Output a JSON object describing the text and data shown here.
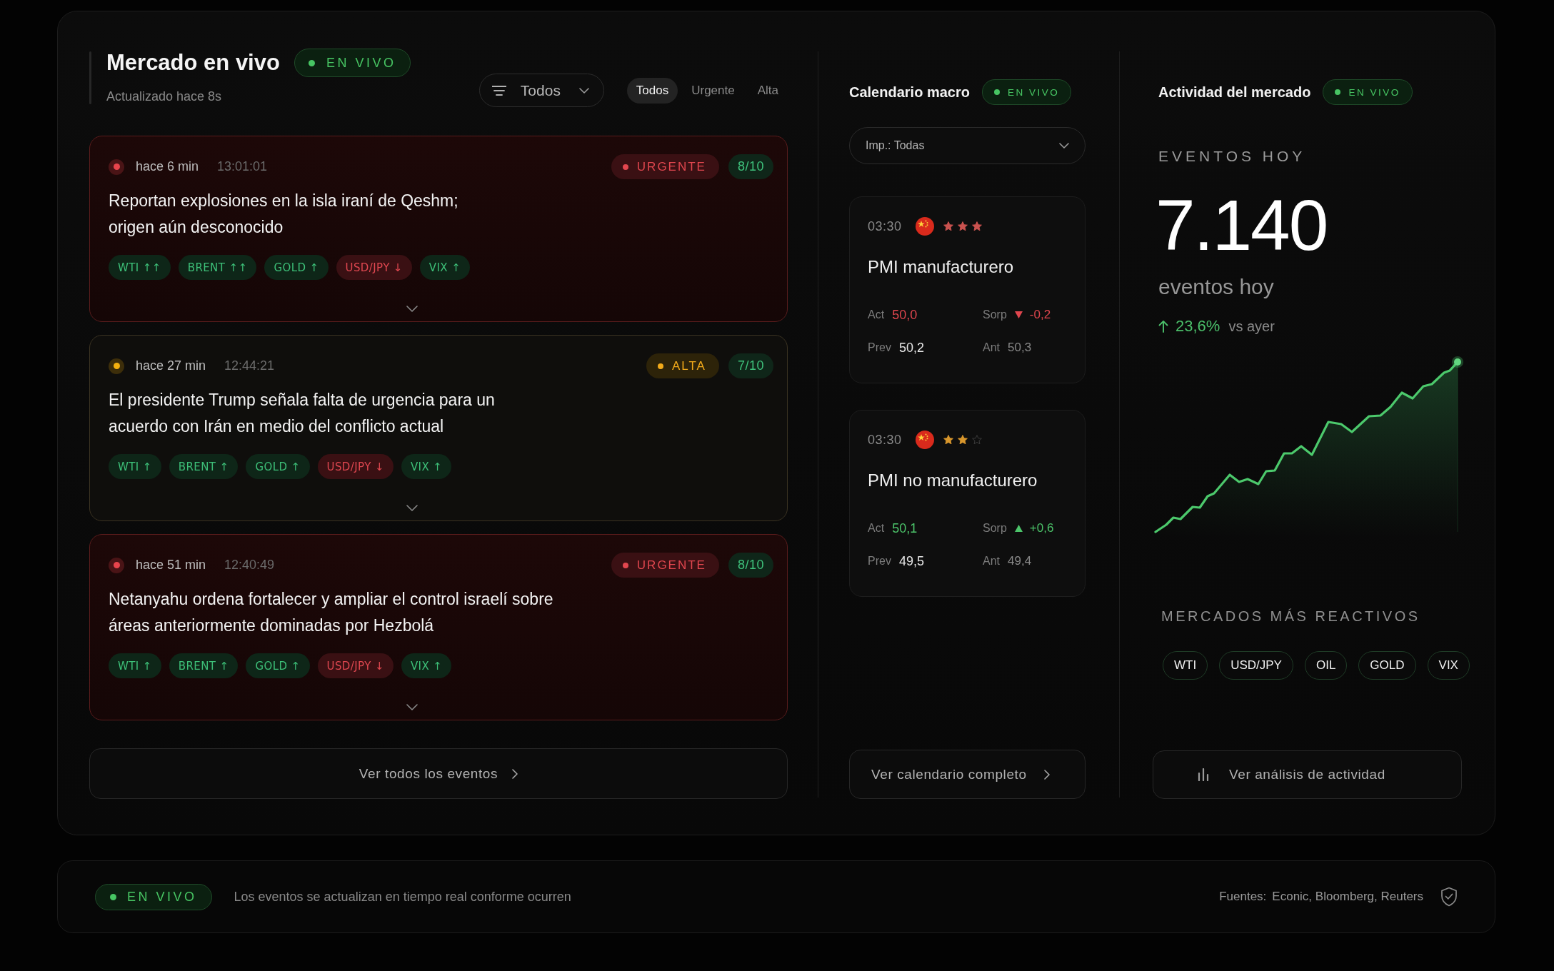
{
  "header": {
    "title": "Mercado en vivo",
    "live_badge": "EN VIVO",
    "subtitle": "Actualizado hace 8s",
    "filter": {
      "value": "Todos"
    },
    "tabs": [
      {
        "label": "Todos",
        "selected": true
      },
      {
        "label": "Urgente",
        "selected": false
      },
      {
        "label": "Alta",
        "selected": false
      }
    ]
  },
  "events": [
    {
      "kind": "urgent",
      "age": "hace 6 min",
      "time": "13:01:01",
      "badge": "URGENTE",
      "score": "8/10",
      "headline": "Reportan explosiones en la isla iraní de Qeshm;\norigen aún desconocido",
      "tags": [
        {
          "label": "WTI ↑↑",
          "rising": true
        },
        {
          "label": "BRENT ↑↑",
          "rising": true
        },
        {
          "label": "GOLD ↑",
          "rising": true
        },
        {
          "label": "USD/JPY ↓",
          "rising": false
        },
        {
          "label": "VIX ↑",
          "rising": true
        }
      ]
    },
    {
      "kind": "high",
      "age": "hace 27 min",
      "time": "12:44:21",
      "badge": "ALTA",
      "score": "7/10",
      "headline": "El presidente Trump señala falta de urgencia para un\nacuerdo con Irán en medio del conflicto actual",
      "tags": [
        {
          "label": "WTI ↑",
          "rising": true
        },
        {
          "label": "BRENT ↑",
          "rising": true
        },
        {
          "label": "GOLD ↑",
          "rising": true
        },
        {
          "label": "USD/JPY ↓",
          "rising": false
        },
        {
          "label": "VIX ↑",
          "rising": true
        }
      ]
    },
    {
      "kind": "urgent",
      "age": "hace 51 min",
      "time": "12:40:49",
      "badge": "URGENTE",
      "score": "8/10",
      "headline": "Netanyahu ordena fortalecer y ampliar el control israelí sobre\náreas anteriormente dominadas por Hezbolá",
      "tags": [
        {
          "label": "WTI ↑",
          "rising": true
        },
        {
          "label": "BRENT ↑",
          "rising": true
        },
        {
          "label": "GOLD ↑",
          "rising": true
        },
        {
          "label": "USD/JPY ↓",
          "rising": false
        },
        {
          "label": "VIX ↑",
          "rising": true
        }
      ]
    }
  ],
  "events_button": "Ver todos los eventos",
  "calendar": {
    "title": "Calendario macro",
    "live_badge": "EN VIVO",
    "filter": {
      "value": "Imp.: Todas"
    },
    "items": [
      {
        "time": "03:30",
        "stars": 3,
        "title": "PMI manufacturero",
        "rising": false,
        "act_label": "Act",
        "act": "50,0",
        "surprise_label": "Sorp",
        "surprise": "-0,2",
        "prev_label": "Prev",
        "prev": "50,2",
        "ant_label": "Ant",
        "ant": "50,3"
      },
      {
        "time": "03:30",
        "stars": 2,
        "title": "PMI no manufacturero",
        "rising": true,
        "act_label": "Act",
        "act": "50,1",
        "surprise_label": "Sorp",
        "surprise": "+0,6",
        "prev_label": "Prev",
        "prev": "49,5",
        "ant_label": "Ant",
        "ant": "49,4"
      }
    ],
    "button": "Ver calendario completo"
  },
  "activity": {
    "title": "Actividad del mercado",
    "live_badge": "EN VIVO",
    "kicker": "EVENTOS HOY",
    "count": "7.140",
    "count_label": "eventos hoy",
    "change": "23,6%",
    "change_rising": true,
    "change_label": "vs ayer",
    "markets_title": "MERCADOS MÁS REACTIVOS",
    "markets": [
      "WTI",
      "USD/JPY",
      "OIL",
      "GOLD",
      "VIX"
    ],
    "button": "Ver análisis de actividad"
  },
  "footer": {
    "live_badge": "EN VIVO",
    "message": "Los eventos se actualizan en tiempo real conforme ocurren",
    "sources_label": "Fuentes:",
    "sources": "Econic, Bloomberg, Reuters"
  }
}
